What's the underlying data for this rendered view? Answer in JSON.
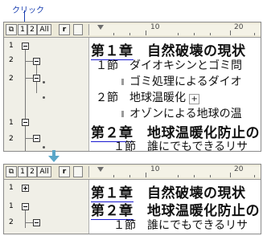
{
  "annotation": {
    "click_label": "クリック"
  },
  "toolbar": {
    "levels": [
      "1",
      "2",
      "All"
    ],
    "ruler_numbers": [
      "10",
      "20"
    ]
  },
  "top": {
    "nav_levels": [
      "1",
      "2",
      "2",
      "1",
      "2"
    ],
    "doc": [
      {
        "kind": "chapter",
        "num": "第１章",
        "text": "自然破壊の現状"
      },
      {
        "kind": "section",
        "text": "１節　ダイオキシンとゴミ問"
      },
      {
        "kind": "sub",
        "text": "ゴミ処理によるダイオ"
      },
      {
        "kind": "section",
        "text": "２節　地球温暖化"
      },
      {
        "kind": "sub",
        "text": "オゾンによる地球の温"
      },
      {
        "kind": "chapter",
        "num": "第２章",
        "text": "地球温暖化防止の"
      },
      {
        "kind": "section",
        "text": "１節　誰にでもできるリサ"
      }
    ]
  },
  "bottom": {
    "nav_levels": [
      "1",
      "1",
      "2"
    ],
    "doc": [
      {
        "kind": "chapter",
        "num": "第１章",
        "text": "自然破壊の現状"
      },
      {
        "kind": "chapter",
        "num": "第２章",
        "text": "地球温暖化防止の"
      },
      {
        "kind": "section",
        "text": "１節　誰にでもできるリサ"
      }
    ]
  }
}
